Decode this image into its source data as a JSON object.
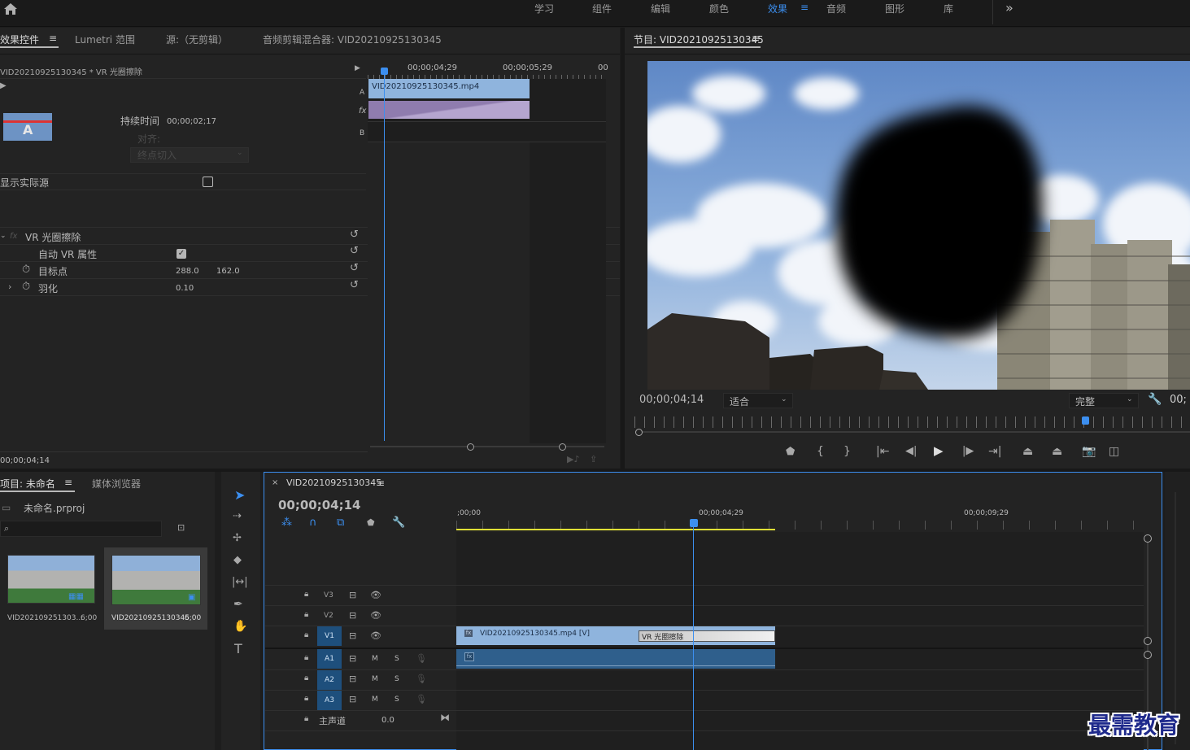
{
  "workspaces": [
    "学习",
    "组件",
    "编辑",
    "颜色",
    "效果",
    "音频",
    "图形",
    "库"
  ],
  "workspace_active": "效果",
  "ws_menu_icon": "≡",
  "overflow_icon": "»",
  "home_icon": "home-icon",
  "source_tabs": {
    "effect_controls": "效果控件",
    "effect_controls_menu": "≡",
    "lumetri": "Lumetri 范围",
    "source": "源:（无剪辑）",
    "audio_mixer": "音频剪辑混合器: VID20210925130345"
  },
  "effect_controls": {
    "clip_path": "VID20210925130345 * VR 光圈擦除",
    "duration_label": "持续时间",
    "duration_value": "00;00;02;17",
    "align_label": "对齐:",
    "align_value": "终点切入",
    "show_source_label": "显示实际源",
    "effect_fx": "fx",
    "effect_name": "VR 光圈擦除",
    "auto_vr_label": "自动 VR 属性",
    "target_label": "目标点",
    "target_x": "288.0",
    "target_y": "162.0",
    "feather_label": "羽化",
    "feather_value": "0.10",
    "time_start": "00;00;04;29",
    "time_end": "00;00;05;29",
    "time_edge": "00",
    "track_a": "A",
    "track_b": "B",
    "clip_name": "VID20210925130345.mp4",
    "current_time": "00;00;04;14"
  },
  "program": {
    "title": "节目: VID20210925130345",
    "menu": "≡",
    "timecode": "00;00;04;14",
    "fit_label": "适合",
    "quality_label": "完整",
    "tc_right": "00;"
  },
  "project": {
    "title": "项目: 未命名",
    "menu": "≡",
    "media_browser": "媒体浏览器",
    "file_name": "未命名.prproj",
    "items": [
      {
        "name": "VID202109251303...",
        "duration": "6;00"
      },
      {
        "name": "VID20210925130345",
        "duration": "6;00"
      }
    ]
  },
  "timeline": {
    "close": "×",
    "title": "VID20210925130345",
    "menu": "≡",
    "timecode": "00;00;04;14",
    "ruler": [
      ";00;00",
      "00;00;04;29",
      "00;00;09;29"
    ],
    "video_tracks": [
      "V3",
      "V2",
      "V1"
    ],
    "audio_tracks": [
      "A1",
      "A2",
      "A3"
    ],
    "mute": "M",
    "solo": "S",
    "master_label": "主声道",
    "master_value": "0.0",
    "clip_name": "VID20210925130345.mp4 [V]",
    "transition_label": "VR 光圈擦除",
    "fx_badge": "fx"
  },
  "watermark": "最需教育",
  "colors": {
    "accent": "#3c8ff0",
    "clip": "#8fb4dd",
    "transition": "#b5a5cf",
    "audio_clip": "#2f5f8c"
  }
}
